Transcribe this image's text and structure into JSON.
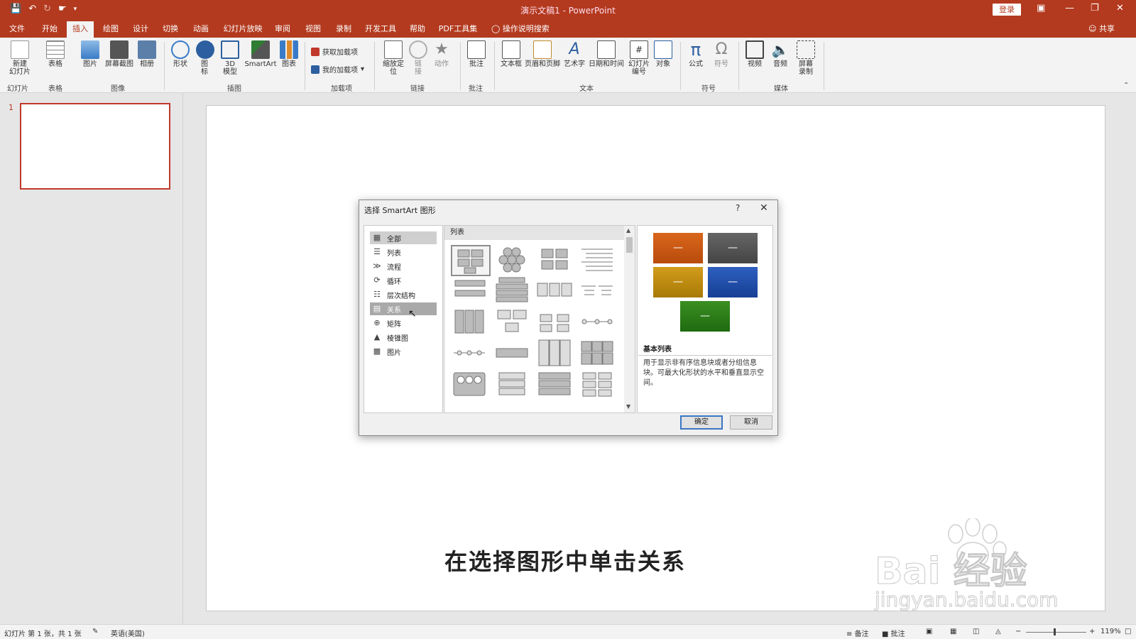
{
  "app": {
    "title": "演示文稿1 - PowerPoint",
    "login": "登录",
    "share": "共享",
    "search_tab": "操作说明搜索"
  },
  "tabs": [
    "文件",
    "开始",
    "插入",
    "绘图",
    "设计",
    "切换",
    "动画",
    "幻灯片放映",
    "审阅",
    "视图",
    "录制",
    "开发工具",
    "帮助",
    "PDF工具集"
  ],
  "active_tab": "插入",
  "ribbon": {
    "buttons": {
      "new_slide": "新建\n幻灯片",
      "table": "表格",
      "picture": "图片",
      "screenshot": "屏幕截图",
      "album": "相册",
      "shapes": "形状",
      "icons": "图\n标",
      "model3d": "3D\n模型",
      "smartart": "SmartArt",
      "chart": "图表",
      "get_addins": "获取加载项",
      "my_addins": "我的加载项",
      "zoom": "缩放定\n位",
      "link": "链\n接",
      "action": "动作",
      "comment": "批注",
      "textbox": "文本框",
      "header_footer": "页眉和页脚",
      "wordart": "艺术字",
      "datetime": "日期和时间",
      "slide_number": "幻灯片\n编号",
      "object": "对象",
      "equation": "公式",
      "symbol": "符号",
      "video": "视频",
      "audio": "音频",
      "screen_record": "屏幕\n录制"
    },
    "groups": {
      "slides": "幻灯片",
      "tables": "表格",
      "images": "图像",
      "illustrations": "插图",
      "addins": "加载项",
      "links": "链接",
      "comments": "批注",
      "text": "文本",
      "symbols": "符号",
      "media": "媒体"
    }
  },
  "thumbnail": {
    "number": "1"
  },
  "dialog": {
    "title": "选择 SmartArt 图形",
    "help": "?",
    "categories": [
      "全部",
      "列表",
      "流程",
      "循环",
      "层次结构",
      "关系",
      "矩阵",
      "棱锥图",
      "图片"
    ],
    "selected_category": "全部",
    "hover_category": "关系",
    "gallery_header": "列表",
    "preview_name": "基本列表",
    "preview_desc": "用于显示非有序信息块或者分组信息块。可最大化形状的水平和垂直显示空间。",
    "ok": "确定",
    "cancel": "取消",
    "preview_colors": [
      "#c55a11",
      "#595959",
      "#bf8f00",
      "#2250a8",
      "#2e7d1a"
    ],
    "preview_dash": "—"
  },
  "caption": "在选择图形中单击关系",
  "watermark": {
    "brand": "Bai 经验",
    "url": "jingyan.baidu.com"
  },
  "status": {
    "slide_info": "幻灯片 第 1 张，共 1 张",
    "language": "英语(美国)",
    "notes": "备注",
    "comments": "批注",
    "zoom": "119%"
  },
  "colors": {
    "accent": "#b33a1f"
  }
}
